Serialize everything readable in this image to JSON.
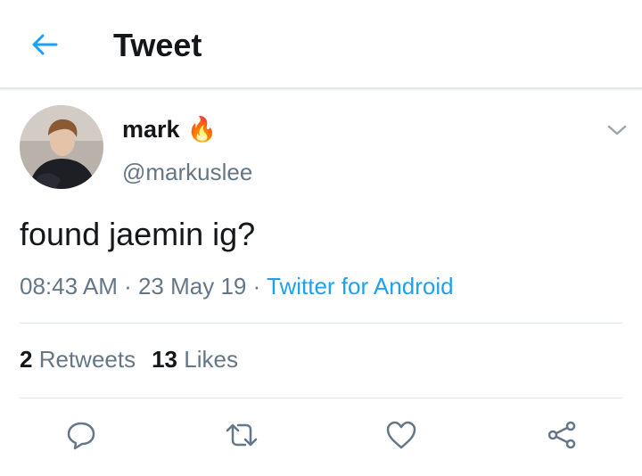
{
  "header": {
    "back_icon": "arrow-left-icon",
    "title": "Tweet"
  },
  "colors": {
    "accent": "#1da1f2",
    "secondary_text": "#657786",
    "primary_text": "#14171a",
    "divider": "#e1e8ed"
  },
  "tweet": {
    "author": {
      "display_name": "mark",
      "emoji": "🔥",
      "handle": "@markuslee"
    },
    "text": "found jaemin ig?",
    "time": "08:43 AM",
    "date": "23 May 19",
    "source": "Twitter for Android",
    "stats": {
      "retweets_count": "2",
      "retweets_label": "Retweets",
      "likes_count": "13",
      "likes_label": "Likes"
    }
  },
  "actions": [
    "reply-icon",
    "retweet-icon",
    "like-icon",
    "share-icon"
  ]
}
